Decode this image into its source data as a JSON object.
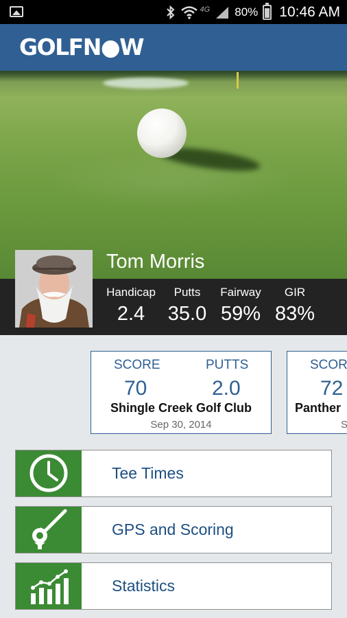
{
  "status_bar": {
    "network": "4G",
    "battery": "80%",
    "time": "10:46 AM"
  },
  "app": {
    "logo": "GOLFN●W"
  },
  "profile": {
    "name": "Tom Morris",
    "stats": [
      {
        "label": "Handicap",
        "value": "2.4"
      },
      {
        "label": "Putts",
        "value": "35.0"
      },
      {
        "label": "Fairway",
        "value": "59%"
      },
      {
        "label": "GIR",
        "value": "83%"
      }
    ]
  },
  "rounds": [
    {
      "score_label": "SCORE",
      "score": "70",
      "putts_label": "PUTTS",
      "putts": "2.0",
      "course": "Shingle Creek Golf Club",
      "date": "Sep 30, 2014"
    },
    {
      "score_label": "SCOR",
      "score": "72",
      "course": "Panther",
      "date": "S"
    }
  ],
  "menu": [
    {
      "label": "Tee Times",
      "icon": "clock-icon"
    },
    {
      "label": "GPS and Scoring",
      "icon": "golf-club-ball-icon"
    },
    {
      "label": "Statistics",
      "icon": "bar-chart-icon"
    }
  ],
  "colors": {
    "brand_blue": "#2f5f93",
    "accent_green": "#3b8a34",
    "stats_band": "#232323"
  }
}
